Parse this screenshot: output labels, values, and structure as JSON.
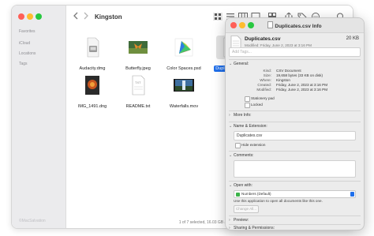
{
  "finder": {
    "sidebar": {
      "items": [
        "Favorites",
        "iCloud",
        "Locations",
        "Tags"
      ],
      "footer": "©MacSalvation"
    },
    "toolbar": {
      "folder_title": "Kingston",
      "back_icon": "chevron-left-icon",
      "forward_icon": "chevron-right-icon"
    },
    "files": [
      {
        "name": "Audacity.dmg",
        "icon": "dmg-icon",
        "selected": false
      },
      {
        "name": "Butterfly.jpeg",
        "icon": "image-icon",
        "selected": false
      },
      {
        "name": "Color Spaces.psd",
        "icon": "psd-icon",
        "selected": false
      },
      {
        "name": "Duplicates.csv",
        "icon": "csv-icon",
        "selected": true
      },
      {
        "name": "IMG_1491.dng",
        "icon": "image-icon",
        "selected": false
      },
      {
        "name": "README.txt",
        "icon": "txt-icon",
        "selected": false
      },
      {
        "name": "Waterfalls.mov",
        "icon": "video-icon",
        "selected": false
      }
    ],
    "status": "1 of 7 selected, 16.03 GB available"
  },
  "info": {
    "window_title": "Duplicates.csv Info",
    "file_name": "Duplicates.csv",
    "file_size": "20 KB",
    "modified_line": "Modified: Friday, June 2, 2023 at 3:16 PM",
    "tags_placeholder": "Add Tags...",
    "general": {
      "header": "General:",
      "kind_label": "Kind:",
      "kind": "CSV Document",
      "size_label": "Size:",
      "size": "19,658 bytes (33 KB on disk)",
      "where_label": "Where:",
      "where": "Kingston",
      "created_label": "Created:",
      "created": "Friday, June 2, 2023 at 3:16 PM",
      "modified_label": "Modified:",
      "modified": "Friday, June 2, 2023 at 3:16 PM",
      "stationery": "Stationery pad",
      "locked": "Locked"
    },
    "more_info": "More Info:",
    "name_ext": {
      "header": "Name & Extension:",
      "value": "Duplicates.csv",
      "hide_ext": "Hide extension"
    },
    "comments": "Comments:",
    "open_with": {
      "header": "Open with:",
      "app": "Numbers (Default)",
      "description": "Use this application to open all documents like this one.",
      "change_all": "Change All..."
    },
    "preview": "Preview:",
    "sharing": "Sharing & Permissions:"
  },
  "colors": {
    "selection_blue": "#1f6feb",
    "close": "#ff5f57",
    "minimize": "#febc2e",
    "zoom": "#28c840"
  }
}
